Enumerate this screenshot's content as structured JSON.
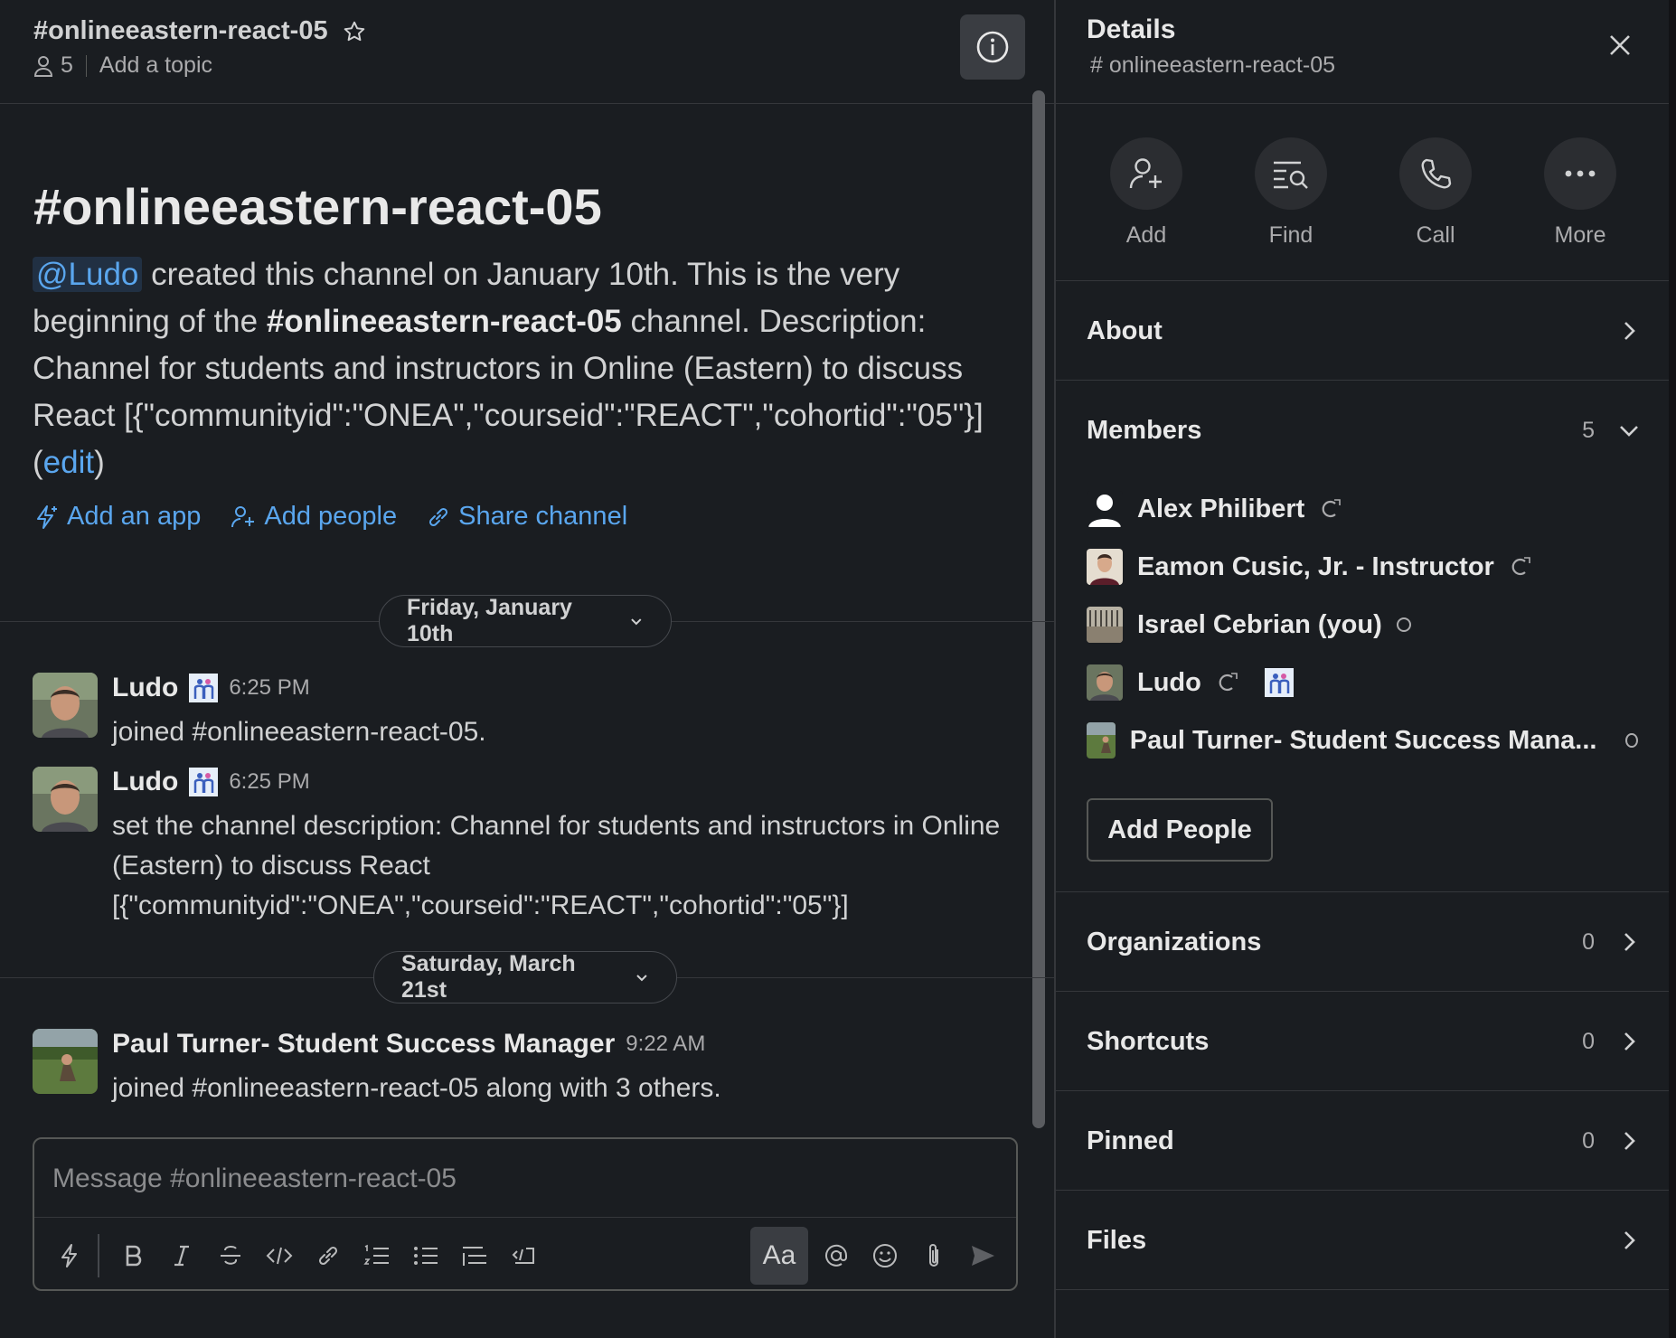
{
  "header": {
    "channel_name": "#onlineeastern-react-05",
    "member_count": "5",
    "topic_placeholder": "Add a topic"
  },
  "intro": {
    "title": "#onlineeastern-react-05",
    "mention": "@Ludo",
    "text_part1": " created this channel on January 10th. This is the very beginning of the ",
    "channel_bold": "#onlineeastern-react-05",
    "text_part2": " channel. Description: Channel for students and instructors in Online (Eastern) to discuss React [{\"communityid\":\"ONEA\",\"courseid\":\"REACT\",\"cohortid\":\"05\"}] (",
    "edit_link": "edit",
    "text_part3": ")",
    "actions": {
      "add_app": "Add an app",
      "add_people": "Add people",
      "share_channel": "Share channel"
    }
  },
  "dates": {
    "first": "Friday, January 10th",
    "second": "Saturday, March 21st"
  },
  "messages": [
    {
      "author": "Ludo",
      "time": "6:25 PM",
      "text": "joined #onlineeastern-react-05."
    },
    {
      "author": "Ludo",
      "time": "6:25 PM",
      "text": "set the channel description: Channel for students and instructors in Online (Eastern) to discuss React [{\"communityid\":\"ONEA\",\"courseid\":\"REACT\",\"cohortid\":\"05\"}]"
    },
    {
      "author": "Paul Turner- Student Success Manager",
      "time": "9:22 AM",
      "text": "joined #onlineeastern-react-05 along with 3 others."
    }
  ],
  "composer": {
    "placeholder": "Message #onlineeastern-react-05",
    "format_button": "Aa"
  },
  "details": {
    "title": "Details",
    "subtitle": "# onlineeastern-react-05",
    "actions": {
      "add": "Add",
      "find": "Find",
      "call": "Call",
      "more": "More"
    },
    "about": "About",
    "members": {
      "label": "Members",
      "count": "5",
      "list": [
        "Alex Philibert",
        "Eamon Cusic, Jr. - Instructor",
        "Israel Cebrian (you)",
        "Ludo",
        "Paul Turner- Student Success Mana..."
      ],
      "add_button": "Add People"
    },
    "organizations": {
      "label": "Organizations",
      "count": "0"
    },
    "shortcuts": {
      "label": "Shortcuts",
      "count": "0"
    },
    "pinned": {
      "label": "Pinned",
      "count": "0"
    },
    "files": {
      "label": "Files"
    }
  }
}
